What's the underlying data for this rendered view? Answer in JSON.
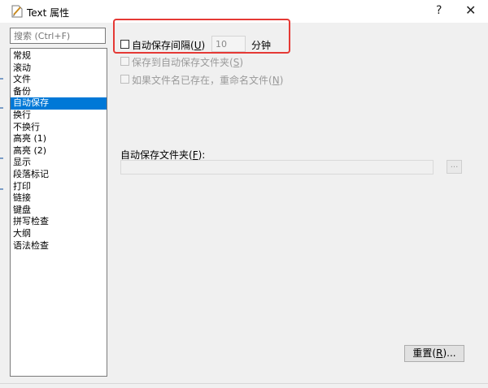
{
  "window": {
    "title": "Text 属性",
    "help_label": "?",
    "close_label": "✕"
  },
  "search": {
    "placeholder": "搜索 (Ctrl+F)"
  },
  "nav": {
    "items": [
      {
        "label": "常规"
      },
      {
        "label": "滚动"
      },
      {
        "label": "文件"
      },
      {
        "label": "备份"
      },
      {
        "label": "自动保存",
        "selected": true
      },
      {
        "label": "换行"
      },
      {
        "label": "不换行"
      },
      {
        "label": "高亮 (1)"
      },
      {
        "label": "高亮 (2)"
      },
      {
        "label": "显示"
      },
      {
        "label": "段落标记"
      },
      {
        "label": "打印"
      },
      {
        "label": "链接"
      },
      {
        "label": "键盘"
      },
      {
        "label": "拼写检查"
      },
      {
        "label": "大纲"
      },
      {
        "label": "语法检查"
      }
    ]
  },
  "autosave": {
    "interval_label": "自动保存间隔",
    "interval_accel": "U",
    "interval_value": "10",
    "minutes_label": "分钟",
    "save_to_folder_label": "保存到自动保存文件夹",
    "save_to_folder_accel": "S",
    "rename_if_exists_label": "如果文件名已存在，重命名文件",
    "rename_if_exists_accel": "N",
    "folder_label": "自动保存文件夹",
    "folder_accel": "F",
    "folder_value": "",
    "browse_label": "..."
  },
  "footer": {
    "reset_label": "重置",
    "reset_accel": "R",
    "reset_suffix": "..."
  },
  "colors": {
    "selection": "#0078d7",
    "highlight_box": "#e53935"
  }
}
